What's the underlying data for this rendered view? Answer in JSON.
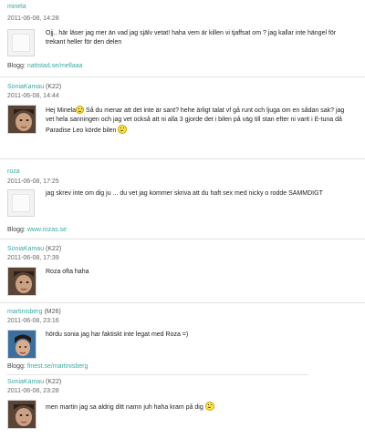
{
  "comments": [
    {
      "author": "minela",
      "age": "",
      "date": "2011-06-08, 14:28",
      "text": "Ojj.. här läser jag mer än vad jag själv vetat! haha vem är killen vi tjaffsat om ? jag kallar inte hängel för trekant heller för den delen",
      "blog_label": "Blogg:",
      "blog_url": "nattstad.se/mellaaa"
    },
    {
      "author": "SoniaKamau",
      "age": "(K22)",
      "date": "2011-06-08, 14:44",
      "text_parts": [
        "Hej Minela",
        " Så du menar att det inte är sant? hehe ärligt talat vf gå runt och ljuga om en sådan sak? jag vet hela sanningen och jag vet också att ni alla 3 gjorde det i bilen på väg till stan efter ni varit i E-tuna då Paradise Leo körde bilen "
      ]
    },
    {
      "author": "roza",
      "age": "",
      "date": "2011-06-08, 17:25",
      "text": "jag skrev inte om dig ju ... du vet jag kommer skriva att du haft sex med nicky o rodde SAMMDIGT",
      "blog_label": "Blogg:",
      "blog_url": "www.rozas.se"
    },
    {
      "author": "SoniaKamau",
      "age": "(K22)",
      "date": "2011-06-08, 17:39",
      "text": "Roza ofta haha"
    },
    {
      "author": "martinisberg",
      "age": "(M26)",
      "date": "2011-06-08, 23:16",
      "text": "hördu sonia jag har faktiskt inte legat med Roza =)",
      "blog_label": "Blogg:",
      "blog_url": "finest.se/martinisberg"
    },
    {
      "author": "SoniaKamau",
      "age": "(K22)",
      "date": "2011-06-08, 23:28",
      "text": "men martin jag sa aldrig ditt namn juh haha kram på dig "
    }
  ],
  "icons": {
    "smiley": "smiley-icon",
    "avatar_placeholder": "avatar-placeholder-icon"
  },
  "colors": {
    "link": "#3aaaa0",
    "separator": "#e3e3e3"
  }
}
